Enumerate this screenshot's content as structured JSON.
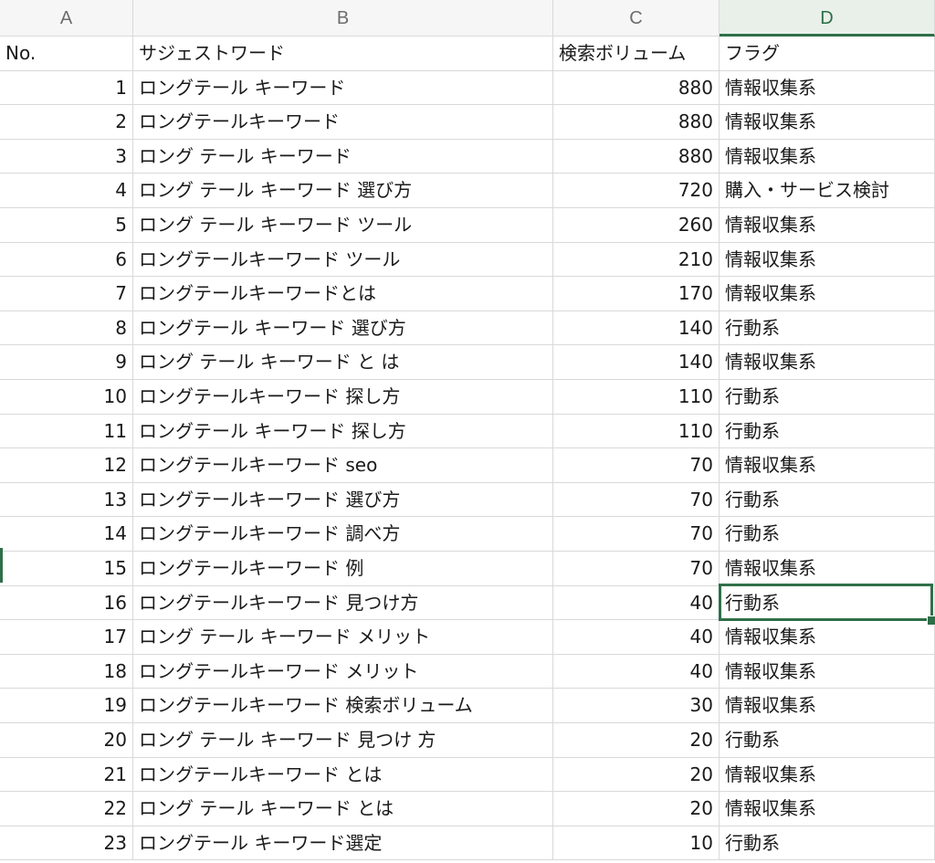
{
  "columns": [
    "A",
    "B",
    "C",
    "D"
  ],
  "active_column": "D",
  "header_row": {
    "no": "No.",
    "suggest_word": "サジェストワード",
    "search_volume": "検索ボリューム",
    "flag": "フラグ"
  },
  "rows": [
    {
      "no": "1",
      "word": "ロングテール キーワード",
      "volume": "880",
      "flag": "情報収集系"
    },
    {
      "no": "2",
      "word": "ロングテールキーワード",
      "volume": "880",
      "flag": "情報収集系"
    },
    {
      "no": "3",
      "word": "ロング テール キーワード",
      "volume": "880",
      "flag": "情報収集系"
    },
    {
      "no": "4",
      "word": "ロング テール キーワード 選び方",
      "volume": "720",
      "flag": "購入・サービス検討"
    },
    {
      "no": "5",
      "word": "ロング テール キーワード ツール",
      "volume": "260",
      "flag": "情報収集系"
    },
    {
      "no": "6",
      "word": "ロングテールキーワード ツール",
      "volume": "210",
      "flag": "情報収集系"
    },
    {
      "no": "7",
      "word": "ロングテールキーワードとは",
      "volume": "170",
      "flag": "情報収集系"
    },
    {
      "no": "8",
      "word": "ロングテール キーワード 選び方",
      "volume": "140",
      "flag": "行動系"
    },
    {
      "no": "9",
      "word": "ロング テール キーワード と は",
      "volume": "140",
      "flag": "情報収集系"
    },
    {
      "no": "10",
      "word": "ロングテールキーワード 探し方",
      "volume": "110",
      "flag": "行動系"
    },
    {
      "no": "11",
      "word": "ロングテール キーワード 探し方",
      "volume": "110",
      "flag": "行動系"
    },
    {
      "no": "12",
      "word": "ロングテールキーワード seo",
      "volume": "70",
      "flag": "情報収集系"
    },
    {
      "no": "13",
      "word": "ロングテールキーワード 選び方",
      "volume": "70",
      "flag": "行動系"
    },
    {
      "no": "14",
      "word": "ロングテールキーワード 調べ方",
      "volume": "70",
      "flag": "行動系"
    },
    {
      "no": "15",
      "word": "ロングテールキーワード 例",
      "volume": "70",
      "flag": "情報収集系"
    },
    {
      "no": "16",
      "word": "ロングテールキーワード 見つけ方",
      "volume": "40",
      "flag": "行動系"
    },
    {
      "no": "17",
      "word": "ロング テール キーワード メリット",
      "volume": "40",
      "flag": "情報収集系"
    },
    {
      "no": "18",
      "word": "ロングテールキーワード メリット",
      "volume": "40",
      "flag": "情報収集系"
    },
    {
      "no": "19",
      "word": "ロングテールキーワード 検索ボリューム",
      "volume": "30",
      "flag": "情報収集系"
    },
    {
      "no": "20",
      "word": "ロング テール キーワード 見つけ 方",
      "volume": "20",
      "flag": "行動系"
    },
    {
      "no": "21",
      "word": "ロングテールキーワード とは",
      "volume": "20",
      "flag": "情報収集系"
    },
    {
      "no": "22",
      "word": "ロング テール キーワード とは",
      "volume": "20",
      "flag": "情報収集系"
    },
    {
      "no": "23",
      "word": "ロングテール キーワード選定",
      "volume": "10",
      "flag": "行動系"
    }
  ],
  "selected_cell": {
    "column": "D",
    "row_no": "16"
  },
  "colors": {
    "accent": "#2f6f48",
    "gridline": "#d9d9d9",
    "header_bg": "#f6f6f6"
  }
}
